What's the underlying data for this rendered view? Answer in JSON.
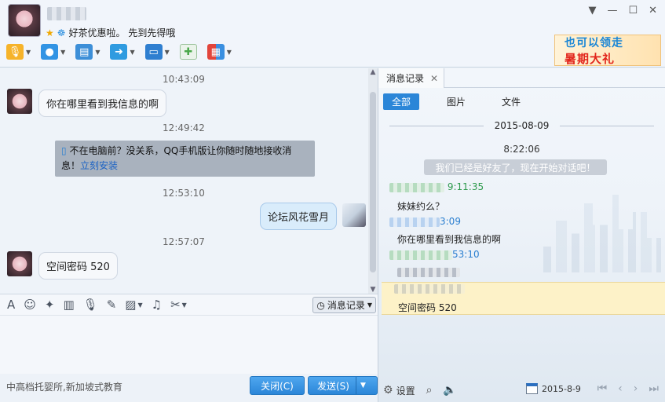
{
  "header": {
    "signature": "好茶优惠啦。 先到先得哦",
    "window_buttons": [
      "▼",
      "—",
      "☐",
      "✕"
    ]
  },
  "toolbar": {
    "items": [
      {
        "name": "voice-call",
        "color": "#f2a516"
      },
      {
        "name": "video-call",
        "color": "#2f8fe0"
      },
      {
        "name": "remote-desktop",
        "color": "#3d8fd8"
      },
      {
        "name": "send-file",
        "color": "#2f9be0"
      },
      {
        "name": "screen-share",
        "color": "#2f7fd0"
      },
      {
        "name": "create-discussion",
        "color": "#4aa84a"
      },
      {
        "name": "apps",
        "color": "#e2453c"
      }
    ]
  },
  "promo": {
    "line1": "也可以领走",
    "line2": "暑期大礼"
  },
  "chat": {
    "t1": "10:43:09",
    "m1": "你在哪里看到我信息的啊",
    "t2": "12:49:42",
    "sys_line1": "不在电脑前？没关系，QQ手机版让你随时随地接收消",
    "sys_line2a": "息！",
    "sys_link": "立刻安装",
    "t3": "12:53:10",
    "m2": "论坛风花雪月",
    "t4": "12:57:07",
    "m3": "空间密码  520"
  },
  "input_toolbar": {
    "history_label": "消息记录"
  },
  "footer": {
    "ad_text": "中高档托婴所,新加坡式教育",
    "close_label": "关闭(C)",
    "send_label": "发送(S)"
  },
  "history": {
    "tab_label": "消息记录",
    "filters": [
      "全部",
      "图片",
      "文件"
    ],
    "date": "2015-08-09",
    "time1": "8:22:06",
    "system_msg": "我们已经是好友了，现在开始对话吧！",
    "e1_time": "9:11:35",
    "e1_msg": "妹妹约么？",
    "e2_time": "3:09",
    "e2_msg": "你在哪里看到我信息的啊",
    "e3_time": "53:10",
    "e4_msg": "空间密码  520",
    "settings_label": "设置",
    "footer_date": "2015-8-9"
  }
}
